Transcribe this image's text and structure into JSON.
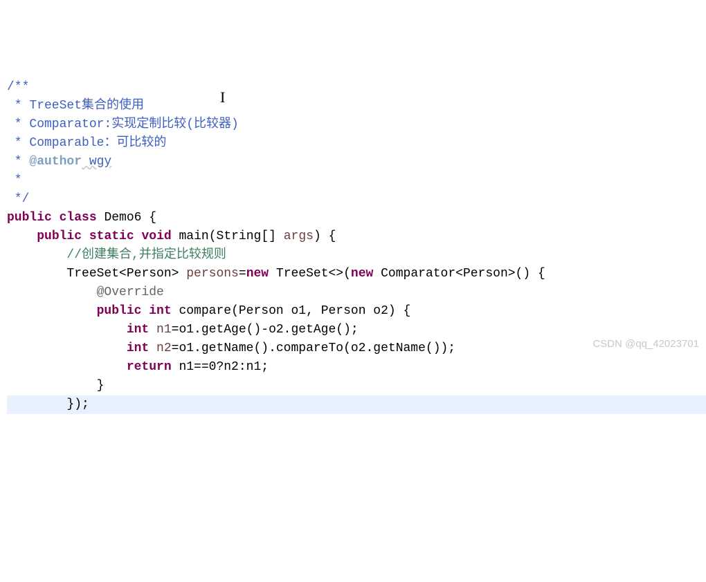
{
  "code": {
    "doc_open": "/**",
    "doc_line1_star": " * ",
    "doc_line1_text": "TreeSet",
    "doc_line1_cn": "集合的使用",
    "doc_line2_star": " * ",
    "doc_line2_text": "Comparator:",
    "doc_line2_cn": "实现定制比较(比较器)",
    "doc_line3_star": " * ",
    "doc_line3_text": "Comparable",
    "doc_line3_cn": "：可比较的",
    "doc_author_star": " * ",
    "doc_author_tag": "@author",
    "doc_author_name": " wgy",
    "doc_empty_star": " *",
    "doc_close": " */",
    "kw_public": "public",
    "kw_class": "class",
    "class_name": "Demo6",
    "brace_open": " {",
    "indent1": "    ",
    "kw_static": "static",
    "kw_void": "void",
    "method_main": "main",
    "param_open": "(",
    "type_string_arr": "String[]",
    "param_args": " args",
    "param_close_brace": ") {",
    "indent2": "        ",
    "comment_create": "//创建集合,并指定比较规则",
    "line_treeset_1": "TreeSet<Person> ",
    "var_persons": "persons",
    "eq": "=",
    "kw_new": "new",
    "line_treeset_2": " TreeSet<>(",
    "line_treeset_3": " Comparator<Person>() {",
    "indent3": "            ",
    "override": "@Override",
    "kw_int": "int",
    "method_compare": " compare",
    "compare_params": "(Person o1, Person o2) {",
    "indent4": "                ",
    "var_n1": " n1",
    "n1_expr": "=o1.getAge()-o2.getAge();",
    "var_n2": " n2",
    "n2_expr": "=o1.getName().compareTo(o2.getName());",
    "kw_return": "return",
    "return_expr": " n1==0?n2:n1;",
    "brace_close": "}",
    "close_paren_semi": "});"
  },
  "watermark": "CSDN @qq_42023701",
  "cursor_char": "I"
}
